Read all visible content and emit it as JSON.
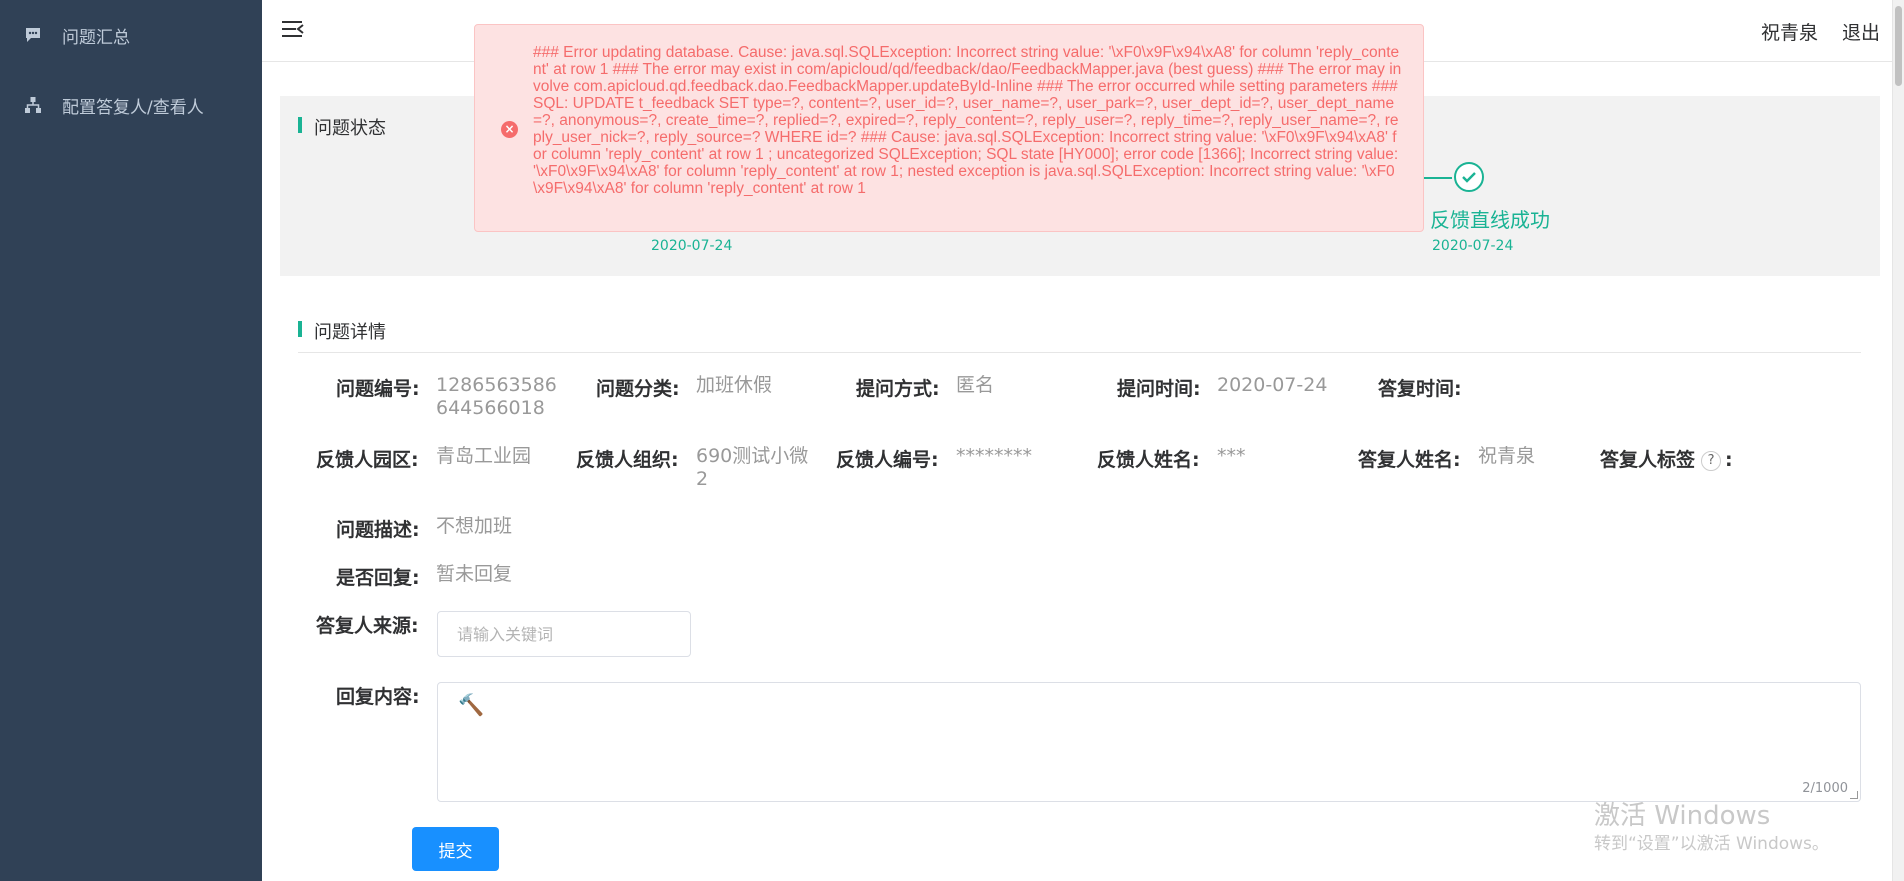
{
  "sidebar": {
    "items": [
      {
        "label": "问题汇总",
        "icon": "chat-icon"
      },
      {
        "label": "配置答复人/查看人",
        "icon": "org-chart-icon"
      }
    ]
  },
  "header": {
    "user_name": "祝青泉",
    "logout_label": "退出"
  },
  "status": {
    "title": "问题状态",
    "steps": [
      {
        "label": "",
        "date": "2020-07-24"
      },
      {
        "label": "反馈直线成功",
        "date": "2020-07-24"
      }
    ]
  },
  "error_toast": {
    "message": "### Error updating database. Cause: java.sql.SQLException: Incorrect string value: '\\xF0\\x9F\\x94\\xA8' for column 'reply_content' at row 1 ### The error may exist in com/apicloud/qd/feedback/dao/FeedbackMapper.java (best guess) ### The error may involve com.apicloud.qd.feedback.dao.FeedbackMapper.updateById-Inline ### The error occurred while setting parameters ### SQL: UPDATE t_feedback SET type=?, content=?, user_id=?, user_name=?, user_park=?, user_dept_id=?, user_dept_name=?, anonymous=?, create_time=?, replied=?, expired=?, reply_content=?, reply_user=?, reply_time=?, reply_user_name=?, reply_user_nick=?, reply_source=? WHERE id=? ### Cause: java.sql.SQLException: Incorrect string value: '\\xF0\\x9F\\x94\\xA8' for column 'reply_content' at row 1 ; uncategorized SQLException; SQL state [HY000]; error code [1366]; Incorrect string value: '\\xF0\\x9F\\x94\\xA8' for column 'reply_content' at row 1; nested exception is java.sql.SQLException: Incorrect string value: '\\xF0\\x9F\\x94\\xA8' for column 'reply_content' at row 1",
    "accent": "#f56c6c"
  },
  "details": {
    "title": "问题详情",
    "question_id": {
      "label": "问题编号:",
      "value": "1286563586644566018"
    },
    "category": {
      "label": "问题分类:",
      "value": "加班休假"
    },
    "ask_method": {
      "label": "提问方式:",
      "value": "匿名"
    },
    "ask_time": {
      "label": "提问时间:",
      "value": "2020-07-24"
    },
    "reply_time": {
      "label": "答复时间:",
      "value": ""
    },
    "park": {
      "label": "反馈人园区:",
      "value": "青岛工业园"
    },
    "org": {
      "label": "反馈人组织:",
      "value": "690测试小微2"
    },
    "user_no": {
      "label": "反馈人编号:",
      "value": "********"
    },
    "user_name": {
      "label": "反馈人姓名:",
      "value": "***"
    },
    "replier_name": {
      "label": "答复人姓名:",
      "value": "祝青泉"
    },
    "replier_tag": {
      "label": "答复人标签",
      "help": "?",
      "colon": ":"
    },
    "description": {
      "label": "问题描述:",
      "value": "不想加班"
    },
    "replied": {
      "label": "是否回复:",
      "value": "暂未回复"
    },
    "source": {
      "label": "答复人来源:",
      "placeholder": "请输入关键词"
    },
    "content": {
      "label": "回复内容:",
      "value": "🔨",
      "counter": "2/1000"
    }
  },
  "submit_label": "提交",
  "watermark": {
    "line1": "激活 Windows",
    "line2": "转到“设置”以激活 Windows。"
  },
  "colors": {
    "sidebar_bg": "#304156",
    "accent_green": "#1ab394",
    "primary": "#1890ff"
  }
}
